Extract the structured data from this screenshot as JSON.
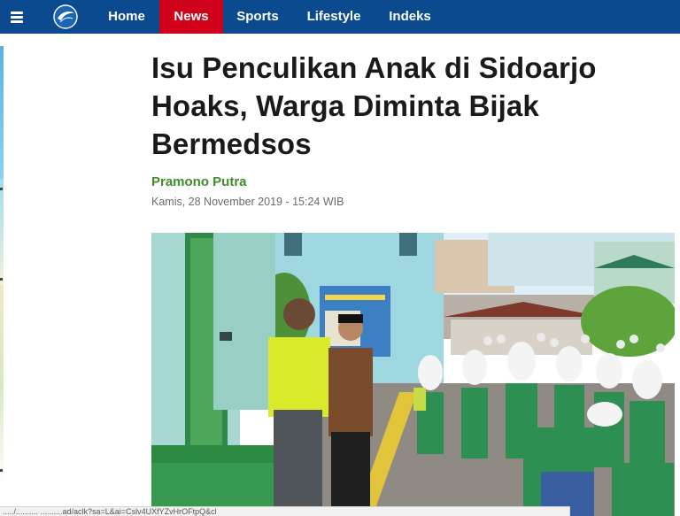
{
  "nav": {
    "items": [
      {
        "label": "Home"
      },
      {
        "label": "News"
      },
      {
        "label": "Sports"
      },
      {
        "label": "Lifestyle"
      },
      {
        "label": "Indeks"
      }
    ],
    "active": "News"
  },
  "article": {
    "title": "Isu Penculikan Anak di Sidoarjo Hoaks, Warga Diminta Bijak Bermedsos",
    "author": "Pramono Putra",
    "date": "Kamis, 28 November 2019 - 15:24 WIB"
  },
  "status_bar": {
    "url": "...../.......... ..........ad/aclk?sa=L&ai=Cslv4UXfYZvHrOFtpQ&cl"
  },
  "colors": {
    "nav_bg": "#0b4a8e",
    "nav_active": "#d0021b",
    "author": "#3f8d2b"
  },
  "icons": [
    "menu-icon",
    "site-logo"
  ]
}
